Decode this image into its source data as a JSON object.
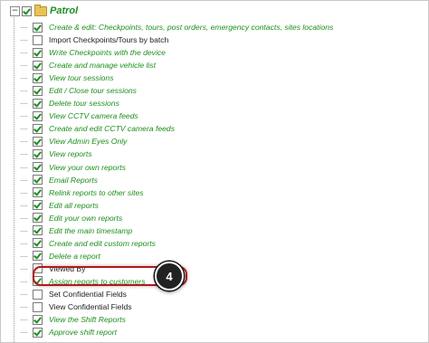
{
  "header": {
    "toggle_symbol": "−",
    "title": "Patrol"
  },
  "items": [
    {
      "label": "Create & edit: Checkpoints, tours, post orders, emergency contacts, sites locations",
      "checked": true
    },
    {
      "label": "Import Checkpoints/Tours by batch",
      "checked": false
    },
    {
      "label": "Write Checkpoints with the device",
      "checked": true
    },
    {
      "label": "Create and manage vehicle list",
      "checked": true
    },
    {
      "label": "View tour sessions",
      "checked": true
    },
    {
      "label": "Edit / Close tour sessions",
      "checked": true
    },
    {
      "label": "Delete tour sessions",
      "checked": true
    },
    {
      "label": "View CCTV camera feeds",
      "checked": true
    },
    {
      "label": "Create and edit CCTV camera feeds",
      "checked": true
    },
    {
      "label": "View Admin Eyes Only",
      "checked": true
    },
    {
      "label": "View reports",
      "checked": true
    },
    {
      "label": "View your own reports",
      "checked": true
    },
    {
      "label": "Email Reports",
      "checked": true
    },
    {
      "label": "Relink reports to other sites",
      "checked": true
    },
    {
      "label": "Edit all reports",
      "checked": true
    },
    {
      "label": "Edit your own reports",
      "checked": true
    },
    {
      "label": "Edit the main timestamp",
      "checked": true
    },
    {
      "label": "Create and edit custom reports",
      "checked": true
    },
    {
      "label": "Delete a report",
      "checked": true
    },
    {
      "label": "Viewed By",
      "checked": false
    },
    {
      "label": "Assign reports to customers",
      "checked": true
    },
    {
      "label": "Set Confidential Fields",
      "checked": false
    },
    {
      "label": "View Confidential Fields",
      "checked": false
    },
    {
      "label": "View the Shift Reports",
      "checked": true
    },
    {
      "label": "Approve shift report",
      "checked": true
    }
  ],
  "callout": {
    "step_number": "4",
    "highlight_color": "#b01a1a"
  },
  "colors": {
    "enabled_text": "#1d8f1d",
    "disabled_text": "#222222"
  }
}
